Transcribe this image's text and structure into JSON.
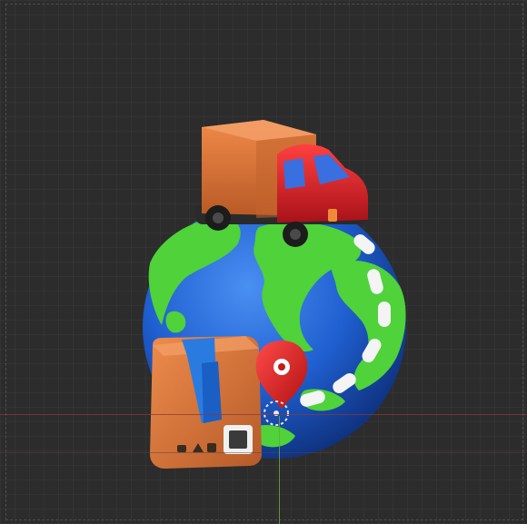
{
  "viewport": {
    "background_color": "#2c2c2c",
    "axis_x_color": "#8a3a3a",
    "axis_y_color": "#6ea63a"
  },
  "scene": {
    "objects": [
      {
        "id": "globe",
        "icon": "globe-icon",
        "ocean_color": "#1f5fd0",
        "land_color": "#4fd23a"
      },
      {
        "id": "truck",
        "icon": "delivery-truck-icon",
        "cargo_color": "#e07a3c",
        "cab_color": "#e0202a"
      },
      {
        "id": "package",
        "icon": "package-box-icon",
        "box_color": "#d9763c",
        "tape_color": "#2a7be0"
      },
      {
        "id": "location-pin",
        "icon": "location-pin-icon",
        "color": "#e02424"
      },
      {
        "id": "route",
        "icon": "dashed-route-icon",
        "color": "#f4f4f4"
      }
    ]
  }
}
